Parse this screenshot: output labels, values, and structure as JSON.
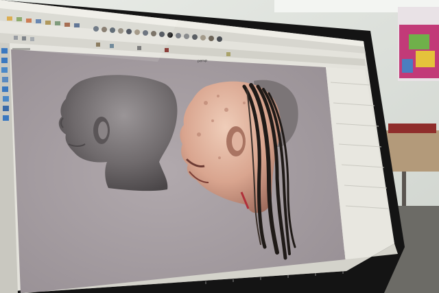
{
  "photo": {
    "subject": "monitor-showing-3d-modeling-software",
    "viewport_label": "persp",
    "colors": {
      "viewport_bg": "#a9a1a5",
      "grey_head": "#7d7779",
      "skin": "#d9a58f",
      "hair": "#1f1a17",
      "ui_panel": "#e4e3dc",
      "bezel": "#141414",
      "wall": "#dfe3de"
    }
  }
}
